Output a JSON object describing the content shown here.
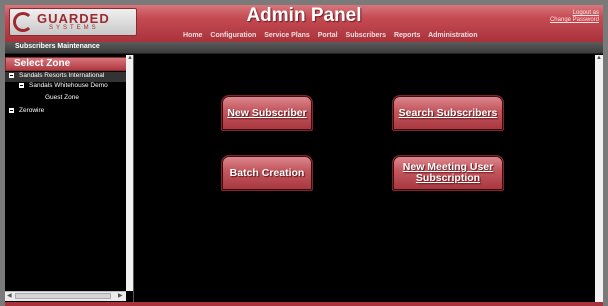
{
  "logo": {
    "name": "GUARDED",
    "tagline": "SYSTEMS"
  },
  "header": {
    "title": "Admin Panel",
    "logout": "Logout as",
    "change_password": "Change Password"
  },
  "nav": [
    {
      "label": "Home"
    },
    {
      "label": "Configuration"
    },
    {
      "label": "Service Plans"
    },
    {
      "label": "Portal"
    },
    {
      "label": "Subscribers"
    },
    {
      "label": "Reports"
    },
    {
      "label": "Administration"
    }
  ],
  "section_title": "Subscribers Maintenance",
  "zone_panel": {
    "title": "Select Zone",
    "tree": [
      {
        "label": "Sandals Resorts International"
      },
      {
        "label": "Sandals Whitehouse Demo"
      },
      {
        "label": "Guest Zone"
      },
      {
        "label": "Zerowire"
      }
    ]
  },
  "actions": [
    {
      "label": "New Subscriber"
    },
    {
      "label": "Search Subscribers"
    },
    {
      "label": "Batch Creation"
    },
    {
      "label": "New Meeting User Subscription"
    }
  ],
  "colors": {
    "accent": "#c54a52",
    "background": "#000000",
    "panel_header": "#4a4a4a"
  }
}
